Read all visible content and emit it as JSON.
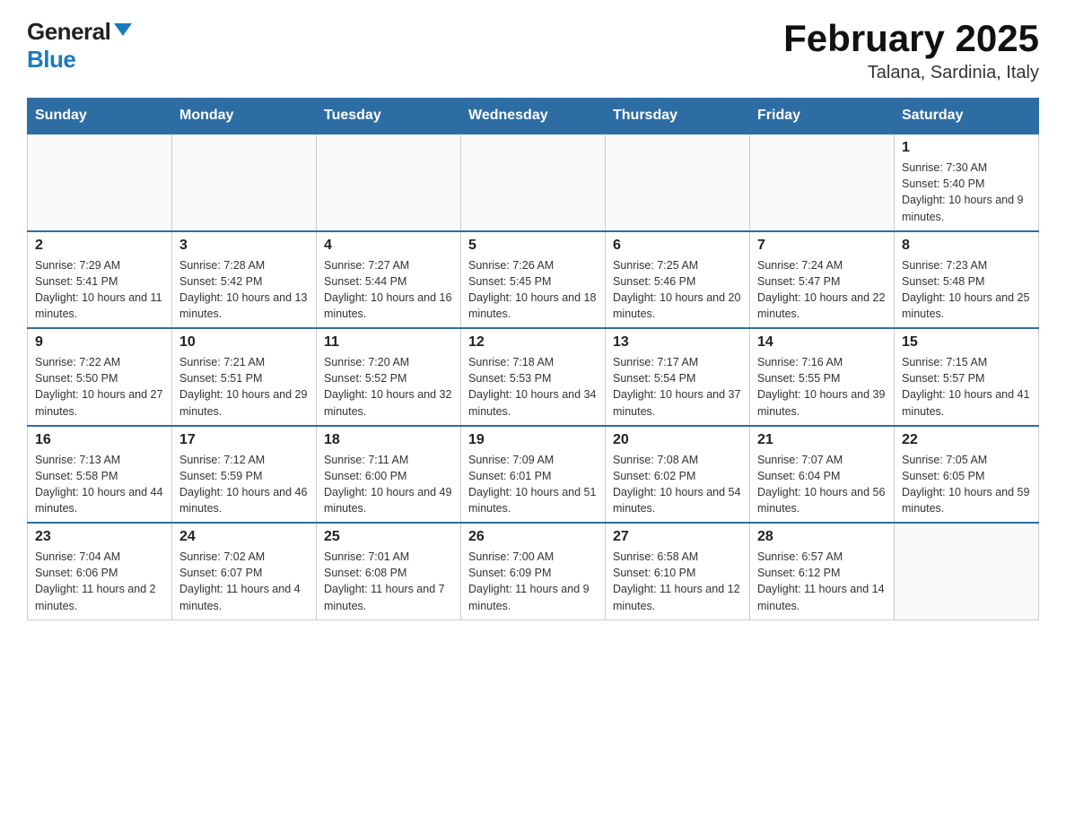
{
  "logo": {
    "general": "General",
    "blue": "Blue"
  },
  "title": "February 2025",
  "subtitle": "Talana, Sardinia, Italy",
  "weekdays": [
    "Sunday",
    "Monday",
    "Tuesday",
    "Wednesday",
    "Thursday",
    "Friday",
    "Saturday"
  ],
  "weeks": [
    [
      null,
      null,
      null,
      null,
      null,
      null,
      {
        "day": "1",
        "sunrise": "Sunrise: 7:30 AM",
        "sunset": "Sunset: 5:40 PM",
        "daylight": "Daylight: 10 hours and 9 minutes."
      }
    ],
    [
      {
        "day": "2",
        "sunrise": "Sunrise: 7:29 AM",
        "sunset": "Sunset: 5:41 PM",
        "daylight": "Daylight: 10 hours and 11 minutes."
      },
      {
        "day": "3",
        "sunrise": "Sunrise: 7:28 AM",
        "sunset": "Sunset: 5:42 PM",
        "daylight": "Daylight: 10 hours and 13 minutes."
      },
      {
        "day": "4",
        "sunrise": "Sunrise: 7:27 AM",
        "sunset": "Sunset: 5:44 PM",
        "daylight": "Daylight: 10 hours and 16 minutes."
      },
      {
        "day": "5",
        "sunrise": "Sunrise: 7:26 AM",
        "sunset": "Sunset: 5:45 PM",
        "daylight": "Daylight: 10 hours and 18 minutes."
      },
      {
        "day": "6",
        "sunrise": "Sunrise: 7:25 AM",
        "sunset": "Sunset: 5:46 PM",
        "daylight": "Daylight: 10 hours and 20 minutes."
      },
      {
        "day": "7",
        "sunrise": "Sunrise: 7:24 AM",
        "sunset": "Sunset: 5:47 PM",
        "daylight": "Daylight: 10 hours and 22 minutes."
      },
      {
        "day": "8",
        "sunrise": "Sunrise: 7:23 AM",
        "sunset": "Sunset: 5:48 PM",
        "daylight": "Daylight: 10 hours and 25 minutes."
      }
    ],
    [
      {
        "day": "9",
        "sunrise": "Sunrise: 7:22 AM",
        "sunset": "Sunset: 5:50 PM",
        "daylight": "Daylight: 10 hours and 27 minutes."
      },
      {
        "day": "10",
        "sunrise": "Sunrise: 7:21 AM",
        "sunset": "Sunset: 5:51 PM",
        "daylight": "Daylight: 10 hours and 29 minutes."
      },
      {
        "day": "11",
        "sunrise": "Sunrise: 7:20 AM",
        "sunset": "Sunset: 5:52 PM",
        "daylight": "Daylight: 10 hours and 32 minutes."
      },
      {
        "day": "12",
        "sunrise": "Sunrise: 7:18 AM",
        "sunset": "Sunset: 5:53 PM",
        "daylight": "Daylight: 10 hours and 34 minutes."
      },
      {
        "day": "13",
        "sunrise": "Sunrise: 7:17 AM",
        "sunset": "Sunset: 5:54 PM",
        "daylight": "Daylight: 10 hours and 37 minutes."
      },
      {
        "day": "14",
        "sunrise": "Sunrise: 7:16 AM",
        "sunset": "Sunset: 5:55 PM",
        "daylight": "Daylight: 10 hours and 39 minutes."
      },
      {
        "day": "15",
        "sunrise": "Sunrise: 7:15 AM",
        "sunset": "Sunset: 5:57 PM",
        "daylight": "Daylight: 10 hours and 41 minutes."
      }
    ],
    [
      {
        "day": "16",
        "sunrise": "Sunrise: 7:13 AM",
        "sunset": "Sunset: 5:58 PM",
        "daylight": "Daylight: 10 hours and 44 minutes."
      },
      {
        "day": "17",
        "sunrise": "Sunrise: 7:12 AM",
        "sunset": "Sunset: 5:59 PM",
        "daylight": "Daylight: 10 hours and 46 minutes."
      },
      {
        "day": "18",
        "sunrise": "Sunrise: 7:11 AM",
        "sunset": "Sunset: 6:00 PM",
        "daylight": "Daylight: 10 hours and 49 minutes."
      },
      {
        "day": "19",
        "sunrise": "Sunrise: 7:09 AM",
        "sunset": "Sunset: 6:01 PM",
        "daylight": "Daylight: 10 hours and 51 minutes."
      },
      {
        "day": "20",
        "sunrise": "Sunrise: 7:08 AM",
        "sunset": "Sunset: 6:02 PM",
        "daylight": "Daylight: 10 hours and 54 minutes."
      },
      {
        "day": "21",
        "sunrise": "Sunrise: 7:07 AM",
        "sunset": "Sunset: 6:04 PM",
        "daylight": "Daylight: 10 hours and 56 minutes."
      },
      {
        "day": "22",
        "sunrise": "Sunrise: 7:05 AM",
        "sunset": "Sunset: 6:05 PM",
        "daylight": "Daylight: 10 hours and 59 minutes."
      }
    ],
    [
      {
        "day": "23",
        "sunrise": "Sunrise: 7:04 AM",
        "sunset": "Sunset: 6:06 PM",
        "daylight": "Daylight: 11 hours and 2 minutes."
      },
      {
        "day": "24",
        "sunrise": "Sunrise: 7:02 AM",
        "sunset": "Sunset: 6:07 PM",
        "daylight": "Daylight: 11 hours and 4 minutes."
      },
      {
        "day": "25",
        "sunrise": "Sunrise: 7:01 AM",
        "sunset": "Sunset: 6:08 PM",
        "daylight": "Daylight: 11 hours and 7 minutes."
      },
      {
        "day": "26",
        "sunrise": "Sunrise: 7:00 AM",
        "sunset": "Sunset: 6:09 PM",
        "daylight": "Daylight: 11 hours and 9 minutes."
      },
      {
        "day": "27",
        "sunrise": "Sunrise: 6:58 AM",
        "sunset": "Sunset: 6:10 PM",
        "daylight": "Daylight: 11 hours and 12 minutes."
      },
      {
        "day": "28",
        "sunrise": "Sunrise: 6:57 AM",
        "sunset": "Sunset: 6:12 PM",
        "daylight": "Daylight: 11 hours and 14 minutes."
      },
      null
    ]
  ]
}
